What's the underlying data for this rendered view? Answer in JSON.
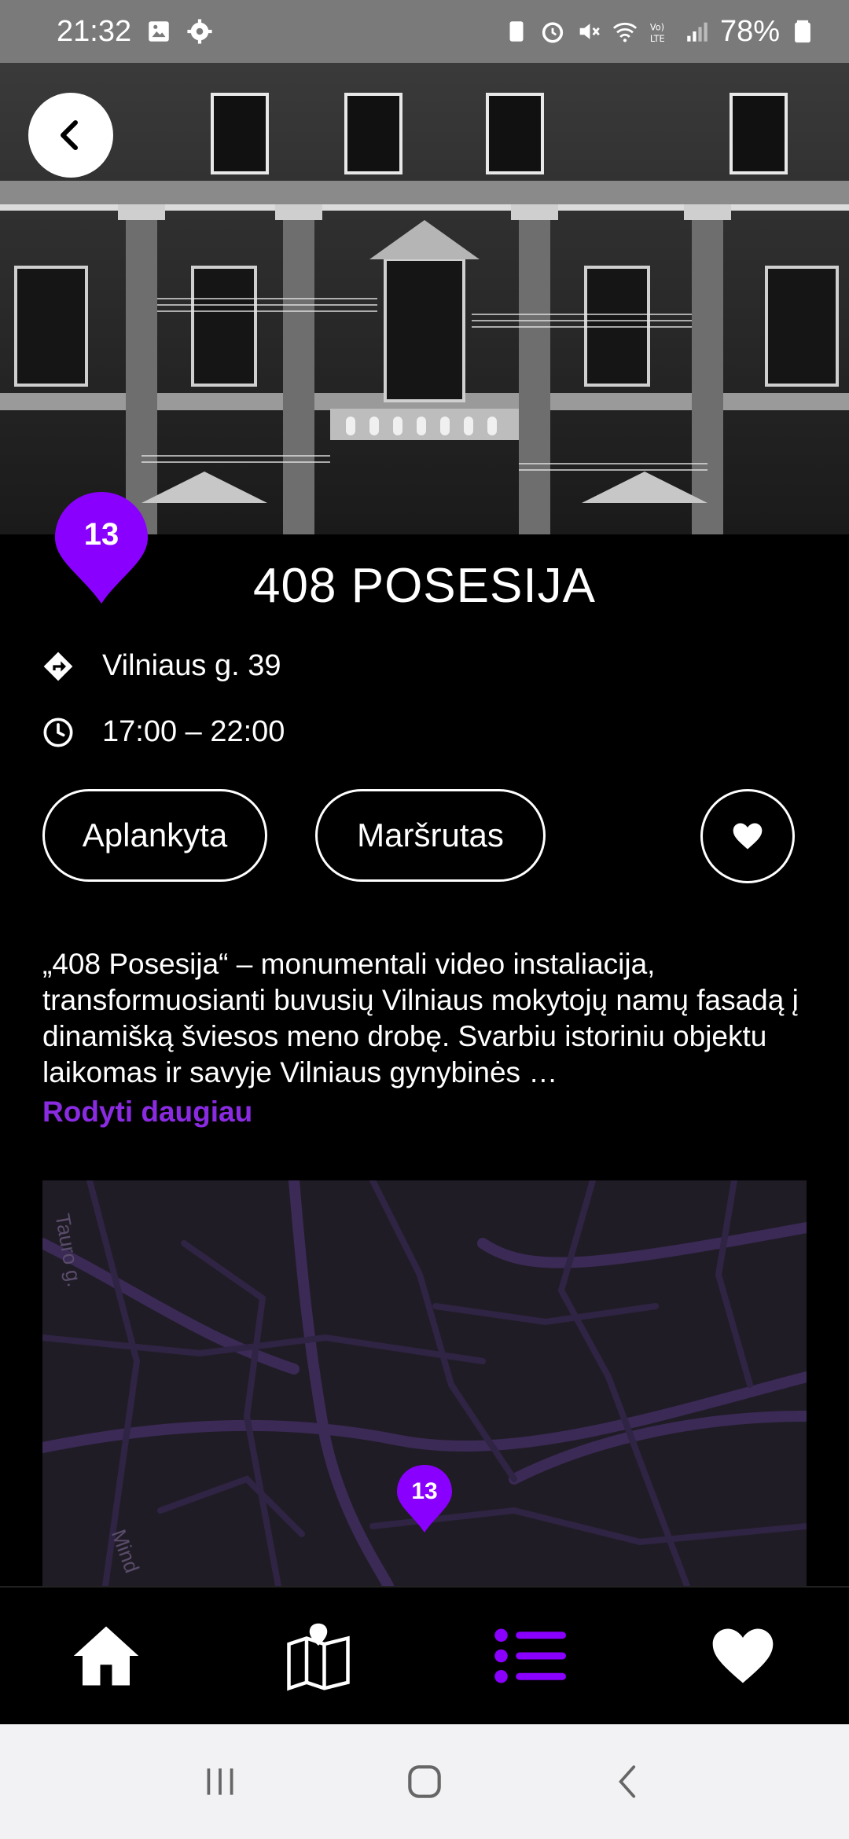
{
  "status_bar": {
    "time": "21:32",
    "battery": "78%",
    "icons_left": [
      "image-icon",
      "gear-icon"
    ],
    "icons_right": [
      "battery-saver-icon",
      "alarm-icon",
      "mute-icon",
      "wifi-icon",
      "volte-icon",
      "signal-icon",
      "battery-icon"
    ]
  },
  "hero": {
    "image_icon": "building-facade-image"
  },
  "place": {
    "number": "13",
    "title": "408 POSESIJA",
    "address": "Vilniaus g. 39",
    "hours": "17:00 – 22:00",
    "description": "„408 Posesija“ – monumentali video instaliacija, transformuosianti buvusių Vilniaus mokytojų namų fasadą į dinamišką šviesos meno drobę. Svarbiu istoriniu objektu laikomas ir savyje Vilniaus gynybinės …",
    "more_label": "Rodyti daugiau"
  },
  "buttons": {
    "visited_label": "Aplankyta",
    "route_label": "Maršrutas"
  },
  "map": {
    "street_labels": [
      "Tauro g.",
      "Mind"
    ],
    "pin_number": "13"
  },
  "colors": {
    "accent": "#8a2be2",
    "background": "#000000",
    "map_background": "#201c26"
  },
  "bottom_nav": [
    "home-icon",
    "map-icon",
    "list-icon",
    "heart-icon"
  ]
}
